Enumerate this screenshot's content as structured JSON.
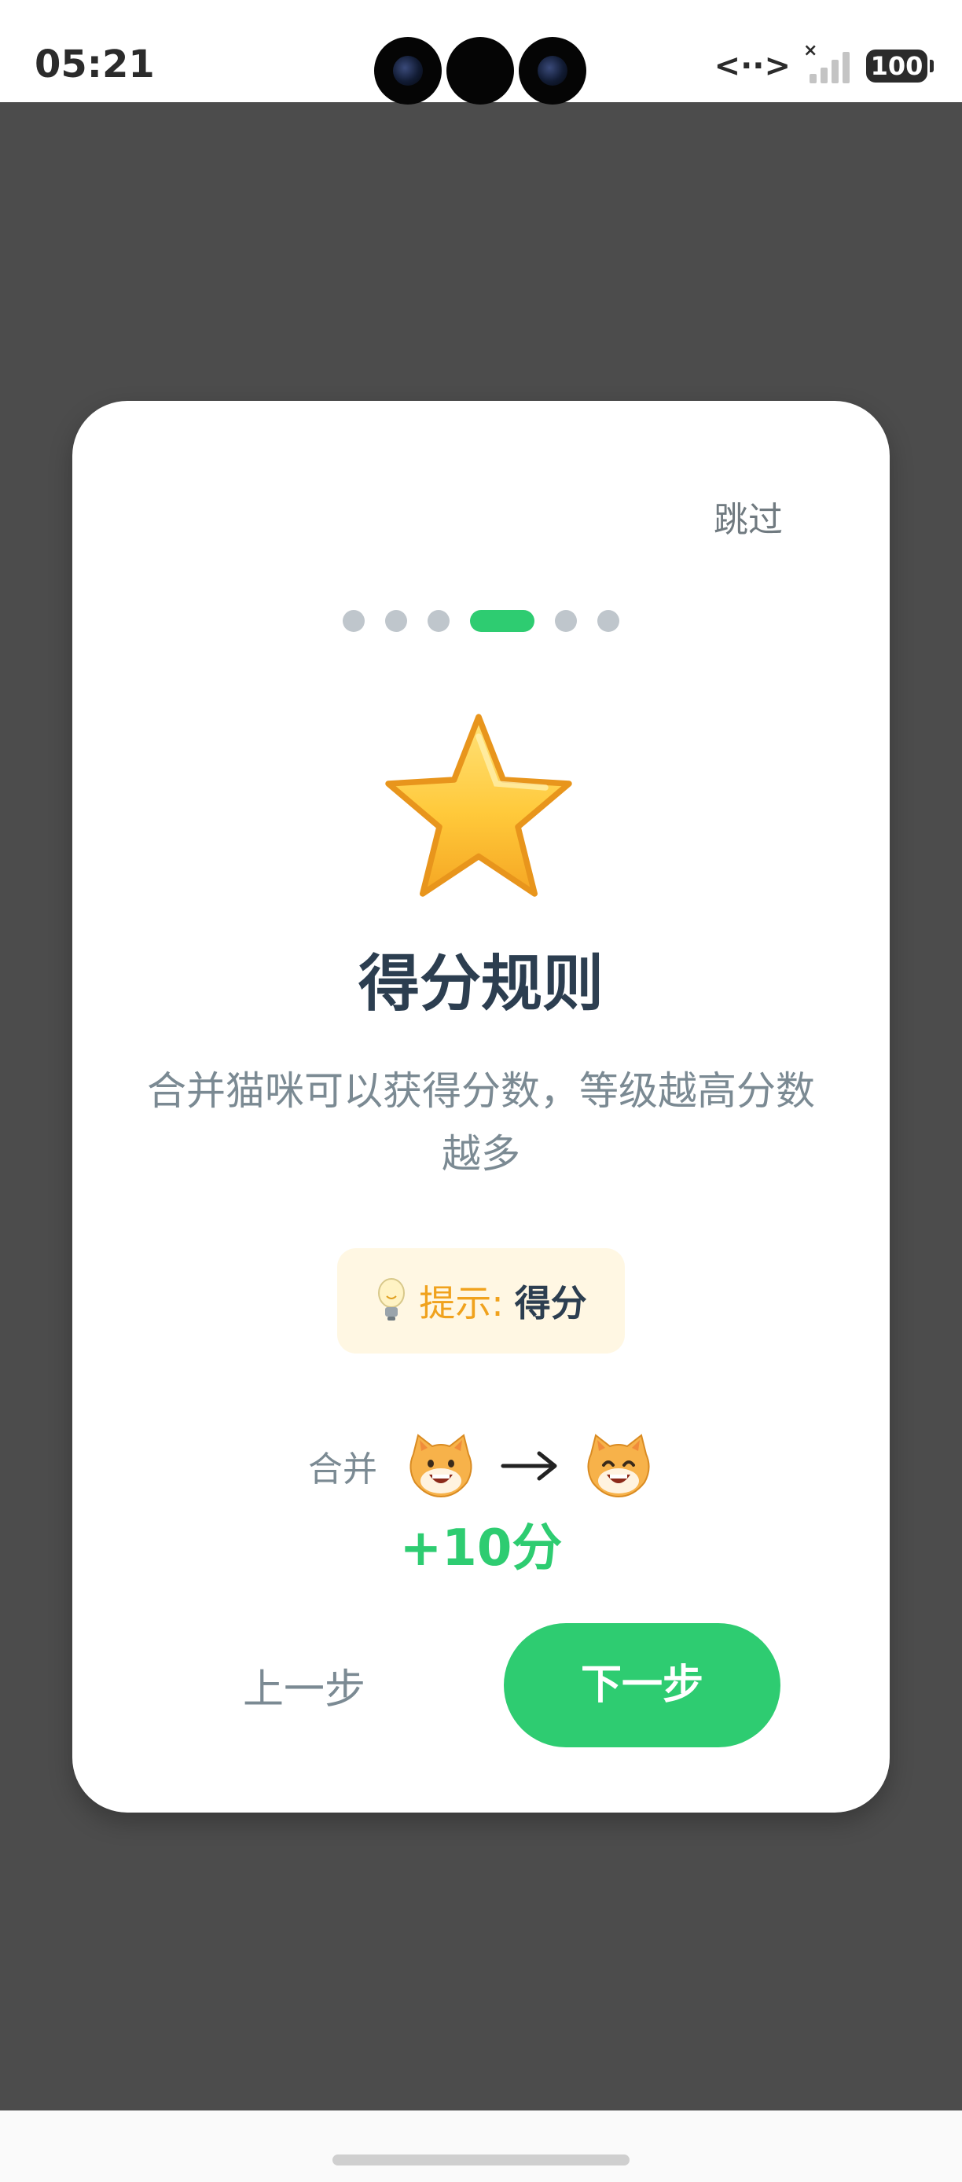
{
  "status_bar": {
    "time": "05:21",
    "data_icon": "<··>",
    "battery": "100",
    "signal_mark": "×"
  },
  "card": {
    "skip_label": "跳过",
    "steps_total": 6,
    "active_step": 4,
    "hero_icon": "star-icon",
    "title": "得分规则",
    "description": "合并猫咪可以获得分数，等级越高分数越多",
    "tip": {
      "label": "提示:",
      "value": "得分",
      "icon": "lightbulb-icon"
    },
    "merge_example": {
      "label": "合并",
      "from_icon": "grinning-cat-icon",
      "arrow": "→",
      "to_icon": "smiling-cat-icon"
    },
    "points": "+10分",
    "prev_label": "上一步",
    "next_label": "下一步"
  },
  "colors": {
    "accent": "#2ecc71",
    "title": "#2c3e50",
    "muted_text": "#7b8a93",
    "tip_background": "#fff7e3",
    "tip_label": "#f0a21d",
    "overlay": "#4c4c4c"
  }
}
